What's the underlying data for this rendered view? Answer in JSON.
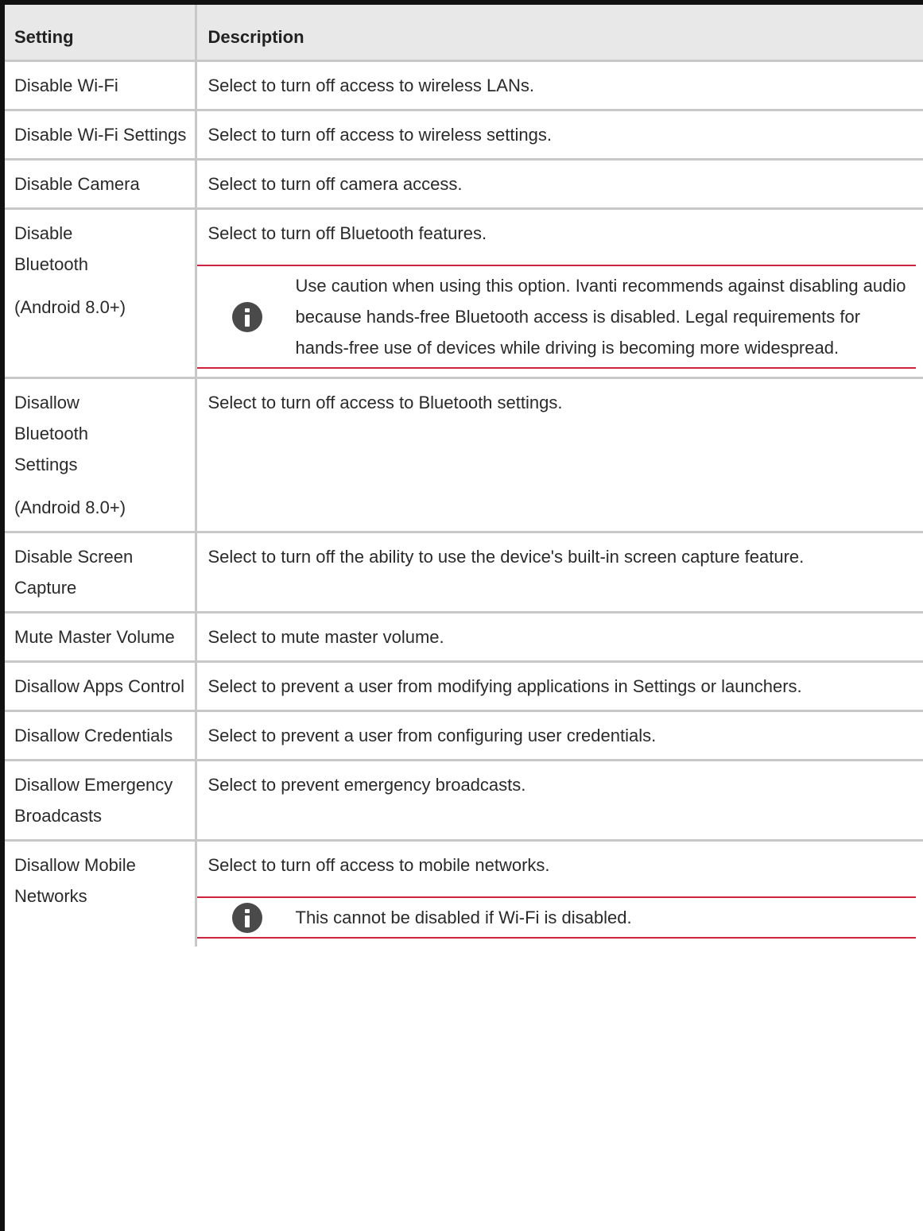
{
  "table": {
    "header": {
      "setting": "Setting",
      "description": "Description"
    },
    "rows": [
      {
        "setting": "Disable Wi-Fi",
        "description": "Select to turn off access to wireless LANs."
      },
      {
        "setting": "Disable Wi-Fi Settings",
        "description": "Select to turn off access to wireless settings."
      },
      {
        "setting": "Disable Camera",
        "description": "Select to turn off camera access."
      },
      {
        "setting": "Disable Bluetooth",
        "platform": "(Android 8.0+)",
        "description": "Select to turn off Bluetooth features.",
        "note": "Use caution when using this option. Ivanti recommends against disabling audio because hands-free Bluetooth access is disabled. Legal requirements for hands-free use of devices while driving is becoming more widespread."
      },
      {
        "setting": "Disallow Bluetooth Settings",
        "platform": "(Android 8.0+)",
        "description": "Select to turn off access to Bluetooth settings."
      },
      {
        "setting": "Disable Screen Capture",
        "description": "Select to turn off the ability to use the device's built-in screen capture feature."
      },
      {
        "setting": "Mute Master Volume",
        "description": "Select to mute master volume."
      },
      {
        "setting": "Disallow Apps Control",
        "description": "Select to prevent a user from modifying applications in Settings or launchers."
      },
      {
        "setting": "Disallow Credentials",
        "description": "Select to prevent a user from configuring user credentials."
      },
      {
        "setting": "Disallow Emergency Broadcasts",
        "description": "Select to prevent emergency broadcasts."
      },
      {
        "setting": "Disallow Mobile Networks",
        "description": "Select to turn off access to mobile networks.",
        "note": "This cannot be disabled if Wi-Fi is disabled."
      }
    ]
  },
  "colors": {
    "note_rule": "#d0223c",
    "header_bg": "#e8e8e8",
    "grid": "#c8c8c8"
  },
  "icons": {
    "note": "info-icon"
  }
}
